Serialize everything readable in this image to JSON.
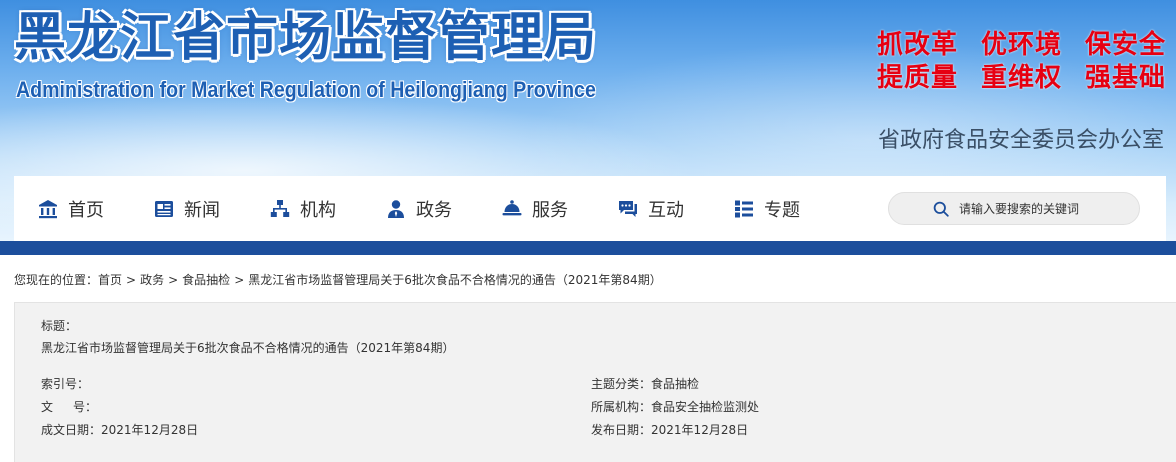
{
  "header": {
    "title": "黑龙江省市场监督管理局",
    "subtitle": "Administration for Market Regulation of Heilongjiang Province",
    "slogans": [
      "抓改革",
      "优环境",
      "保安全",
      "提质量",
      "重维权",
      "强基础"
    ],
    "office": "省政府食品安全委员会办公室",
    "colors": {
      "title": "#1d5fb3",
      "slogan": "#e60012",
      "nav_bar": "#1c4e9c"
    }
  },
  "nav": {
    "items": [
      {
        "label": "首页",
        "icon": "home-icon"
      },
      {
        "label": "新闻",
        "icon": "news-icon"
      },
      {
        "label": "机构",
        "icon": "org-icon"
      },
      {
        "label": "政务",
        "icon": "government-icon"
      },
      {
        "label": "服务",
        "icon": "service-icon"
      },
      {
        "label": "互动",
        "icon": "chat-icon"
      },
      {
        "label": "专题",
        "icon": "topic-icon"
      }
    ],
    "search": {
      "placeholder": "请输入要搜索的关键词",
      "icon": "search-icon"
    }
  },
  "breadcrumb": {
    "prefix": "您现在的位置：",
    "items": [
      "首页",
      "政务",
      "食品抽检",
      "黑龙江省市场监督管理局关于6批次食品不合格情况的通告（2021年第84期）"
    ],
    "separator": ">"
  },
  "info": {
    "title_label": "标题：",
    "title_value": "黑龙江省市场监督管理局关于6批次食品不合格情况的通告（2021年第84期）",
    "index_label": "索引号：",
    "index_value": "",
    "doc_no_label_1": "文",
    "doc_no_label_2": "号：",
    "doc_no_value": "",
    "created_label": "成文日期：",
    "created_value": "2021年12月28日",
    "category_label": "主题分类：",
    "category_value": "食品抽检",
    "org_label": "所属机构：",
    "org_value": "食品安全抽检监测处",
    "published_label": "发布日期：",
    "published_value": "2021年12月28日"
  }
}
